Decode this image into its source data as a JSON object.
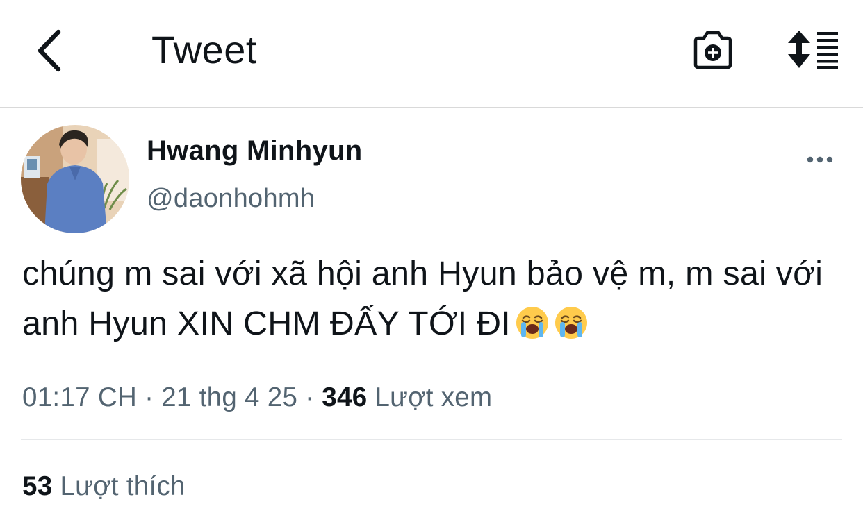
{
  "header": {
    "title": "Tweet",
    "back_icon": "chevron-left-icon",
    "camera_icon": "camera-add-icon",
    "sort_icon": "sort-list-icon"
  },
  "tweet": {
    "author": {
      "display_name": "Hwang Minhyun",
      "handle": "@daonhohmh"
    },
    "text": "chúng m sai với xã hội anh Hyun bảo vệ m, m sai với anh Hyun XIN CHM ĐẤY TỚI ĐI",
    "emojis": [
      "loudly-crying-face-icon",
      "loudly-crying-face-icon"
    ],
    "time": "01:17 CH",
    "separator": "·",
    "date": "21 thg 4 25",
    "views_count": "346",
    "views_label": "Lượt xem",
    "likes_count": "53",
    "likes_label": "Lượt thích",
    "more_icon": "more-horizontal-icon"
  },
  "colors": {
    "text_primary": "#0f1419",
    "text_secondary": "#536471",
    "divider": "#e6e8ea"
  }
}
